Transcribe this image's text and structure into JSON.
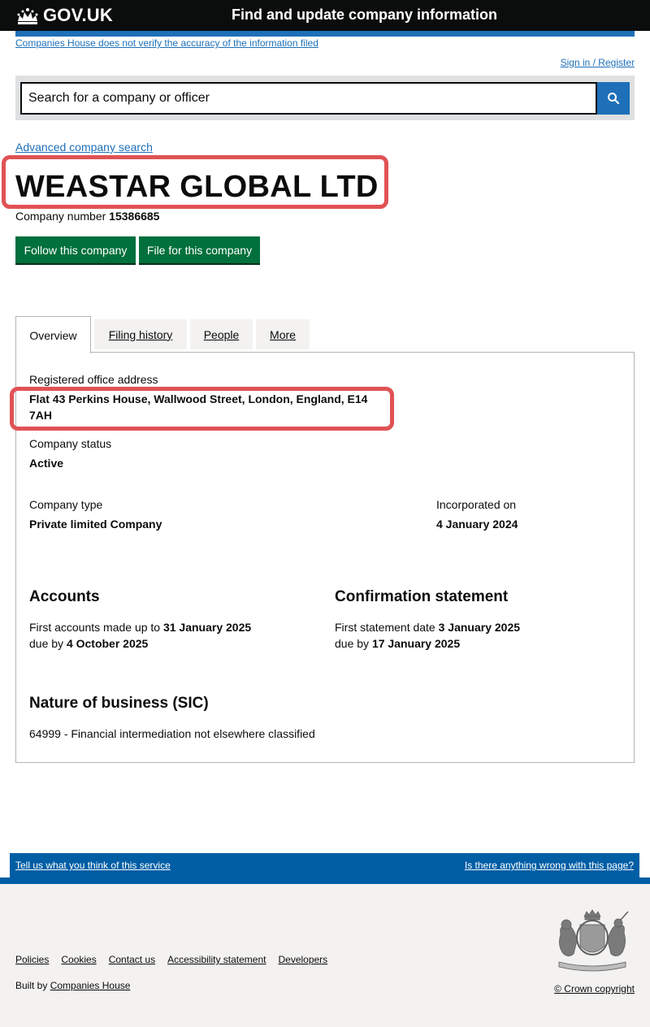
{
  "header": {
    "logo_text": "GOV.UK",
    "service_name": "Find and update company information",
    "disclaimer": "Companies House does not verify the accuracy of the information filed",
    "signin": "Sign in / Register"
  },
  "search": {
    "placeholder": "Search for a company or officer",
    "advanced_link": "Advanced company search"
  },
  "company": {
    "name": "WEASTAR GLOBAL LTD",
    "number_label": "Company number",
    "number": "15386685",
    "follow_button": "Follow this company",
    "file_button": "File for this company"
  },
  "tabs": [
    {
      "label": "Overview"
    },
    {
      "label": "Filing history"
    },
    {
      "label": "People"
    },
    {
      "label": "More"
    }
  ],
  "overview": {
    "address_label": "Registered office address",
    "address_line1": "Flat 43 Perkins House, Wallwood Street, London, England, E14",
    "address_line2": "7AH",
    "status_label": "Company status",
    "status": "Active",
    "type_label": "Company type",
    "type": "Private limited Company",
    "incorporated_label": "Incorporated on",
    "incorporated": "4 January 2024",
    "accounts": {
      "heading": "Accounts",
      "first_label": "First accounts made up to",
      "first_date": "31 January 2025",
      "due_label": "due by",
      "due_date": "4 October 2025"
    },
    "confirmation": {
      "heading": "Confirmation statement",
      "first_label": "First statement date",
      "first_date": "3 January 2025",
      "due_label": "due by",
      "due_date": "17 January 2025"
    },
    "sic": {
      "heading": "Nature of business (SIC)",
      "text": "64999 - Financial intermediation not elsewhere classified"
    }
  },
  "footer": {
    "feedback_left": "Tell us what you think of this service",
    "feedback_right": "Is there anything wrong with this page?",
    "links": [
      "Policies",
      "Cookies",
      "Contact us",
      "Accessibility statement",
      "Developers"
    ],
    "built_by_prefix": "Built by",
    "built_by_link": "Companies House",
    "copyright": "© Crown copyright"
  },
  "colors": {
    "header_bg": "#0b0c0c",
    "brand_blue": "#1d70b8",
    "button_green": "#00703c",
    "highlight_red": "#e05255"
  }
}
